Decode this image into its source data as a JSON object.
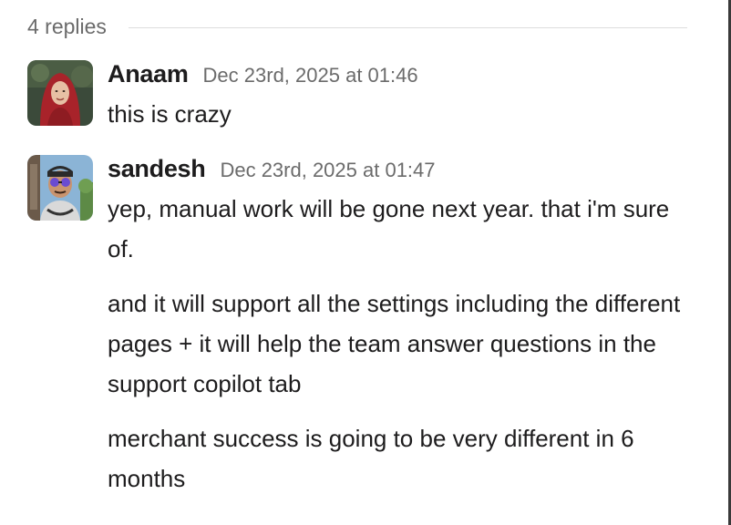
{
  "thread": {
    "replies_label": "4 replies"
  },
  "messages": [
    {
      "author": "Anaam",
      "timestamp": "Dec 23rd, 2025 at 01:46",
      "avatar": "anaam-avatar",
      "paragraphs": [
        "this is crazy"
      ]
    },
    {
      "author": "sandesh",
      "timestamp": "Dec 23rd, 2025 at 01:47",
      "avatar": "sandesh-avatar",
      "paragraphs": [
        "yep, manual work will be gone next year. that i'm sure of.",
        "and it will support all the settings including the different pages + it will help the team answer questions in the support copilot tab",
        "merchant success is going to be very different in 6 months"
      ]
    }
  ]
}
